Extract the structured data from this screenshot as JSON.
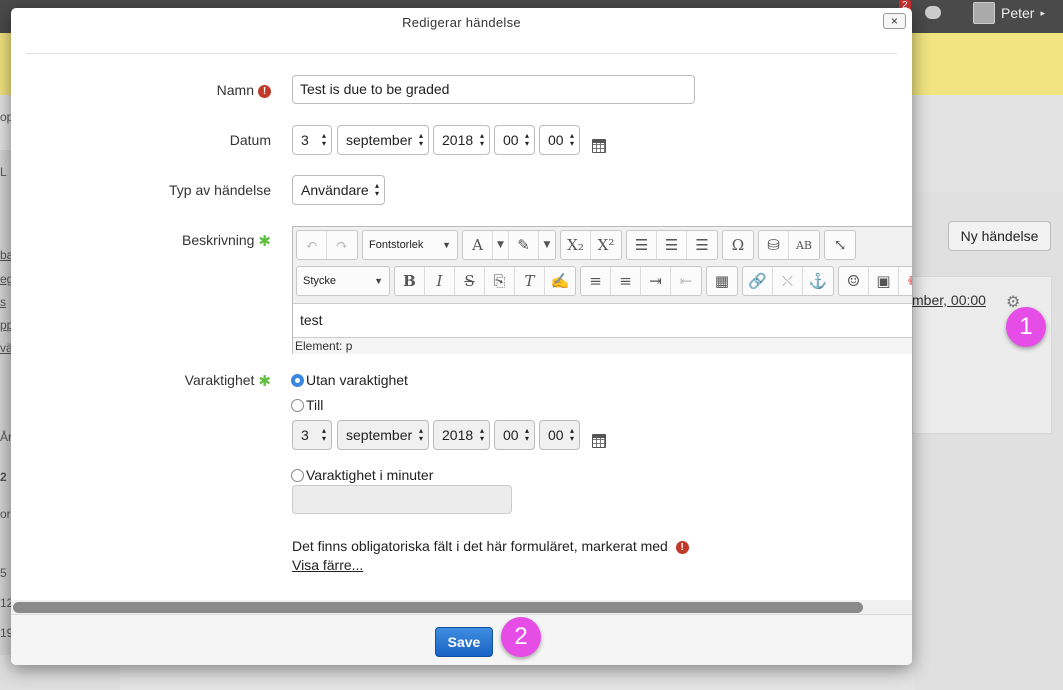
{
  "background": {
    "user_name": "Peter",
    "notification_count": "2",
    "new_event_button": "Ny händelse",
    "event_text": "mber, 00:00",
    "left_fragments": [
      "op",
      "L",
      "ba",
      "eg",
      "s",
      "pp",
      "vä",
      "År",
      "2",
      "or",
      "5",
      "12",
      "19"
    ]
  },
  "annotations": {
    "step1": "1",
    "step2": "2"
  },
  "modal": {
    "title": "Redigerar händelse",
    "close_label": "×",
    "fields": {
      "name_label": "Namn",
      "name_value": "Test is due to be graded",
      "date_label": "Datum",
      "date": {
        "day": "3",
        "month": "september",
        "year": "2018",
        "hour": "00",
        "minute": "00"
      },
      "type_label": "Typ av händelse",
      "type_value": "Användare",
      "description_label": "Beskrivning",
      "duration_label": "Varaktighet"
    },
    "editor": {
      "font_size_label": "Fontstorlek",
      "paragraph_label": "Stycke",
      "content": "test",
      "status": "Element: p",
      "subscript": "X₂",
      "superscript": "X²"
    },
    "duration": {
      "option_none": "Utan varaktighet",
      "option_until": "Till",
      "until": {
        "day": "3",
        "month": "september",
        "year": "2018",
        "hour": "00",
        "minute": "00"
      },
      "option_minutes": "Varaktighet i minuter",
      "minutes_value": ""
    },
    "required_notice": "Det finns obligatoriska fält i det här formuläret, markerat med",
    "show_less": "Visa färre...",
    "save_label": "Save"
  }
}
